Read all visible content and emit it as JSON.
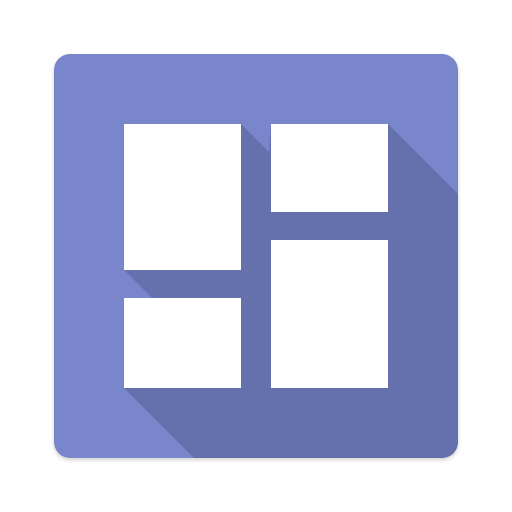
{
  "icon": {
    "name": "dashboard-layout-icon",
    "colors": {
      "background": "#7986CB",
      "long_shadow": "#6571AD",
      "tile": "#FFFFFF",
      "page_background": "#FFFFFF"
    }
  }
}
